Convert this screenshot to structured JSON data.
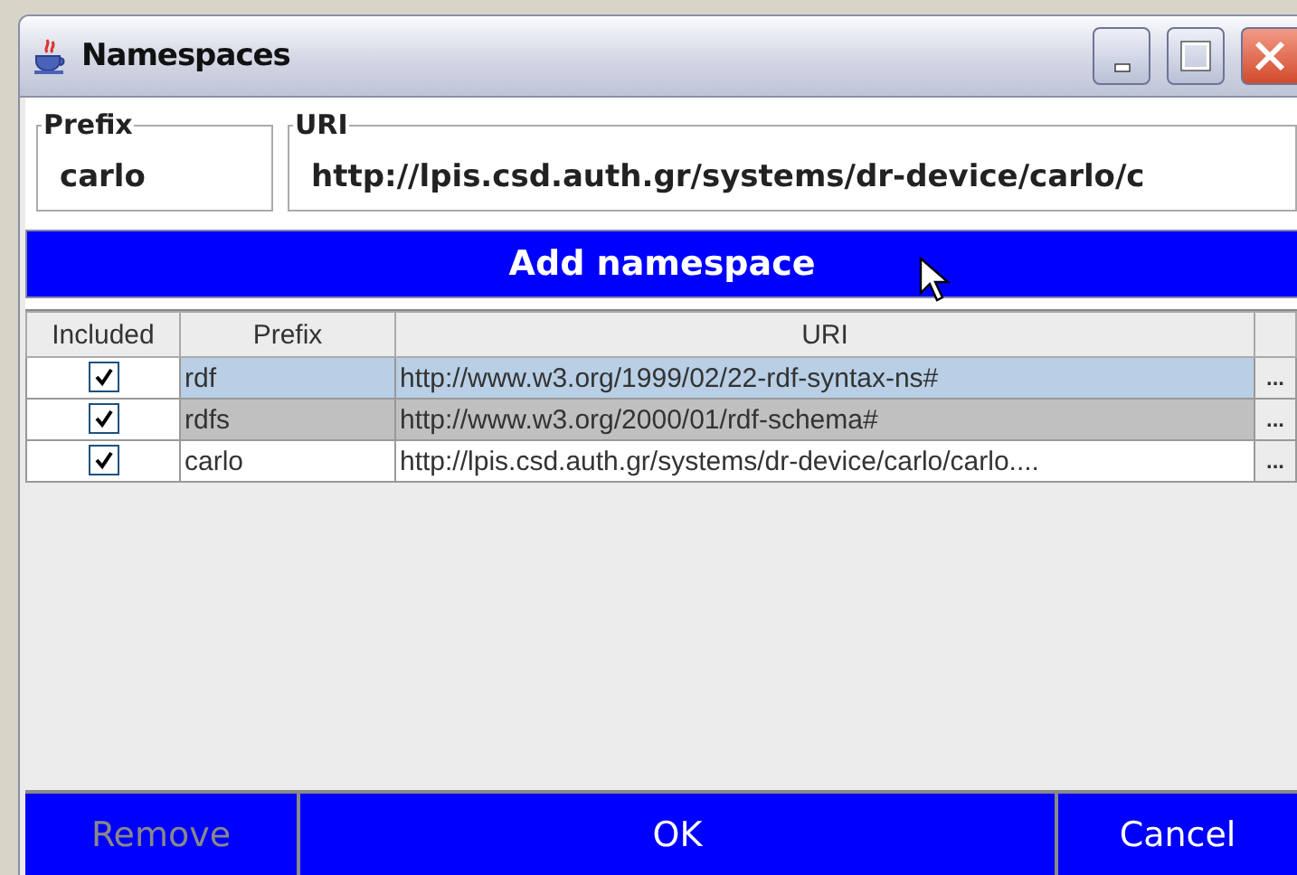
{
  "window": {
    "title": "Namespaces"
  },
  "prefix_group": {
    "legend": "Prefix",
    "value": "carlo"
  },
  "uri_group": {
    "legend": "URI",
    "value": "http://lpis.csd.auth.gr/systems/dr-device/carlo/c"
  },
  "add_button": {
    "label": "Add namespace"
  },
  "table": {
    "columns": [
      "Included",
      "Prefix",
      "URI"
    ],
    "rows": [
      {
        "included": true,
        "prefix": "rdf",
        "uri": "http://www.w3.org/1999/02/22-rdf-syntax-ns#",
        "browse": "...",
        "selected": true,
        "highlighted": false
      },
      {
        "included": true,
        "prefix": "rdfs",
        "uri": "http://www.w3.org/2000/01/rdf-schema#",
        "browse": "...",
        "selected": false,
        "highlighted": true
      },
      {
        "included": true,
        "prefix": "carlo",
        "uri": "http://lpis.csd.auth.gr/systems/dr-device/carlo/carlo....",
        "browse": "...",
        "selected": false,
        "highlighted": false
      }
    ]
  },
  "buttons": [
    {
      "label": "Remove",
      "disabled": true
    },
    {
      "label": "OK",
      "disabled": false
    },
    {
      "label": "Cancel",
      "disabled": false
    }
  ]
}
